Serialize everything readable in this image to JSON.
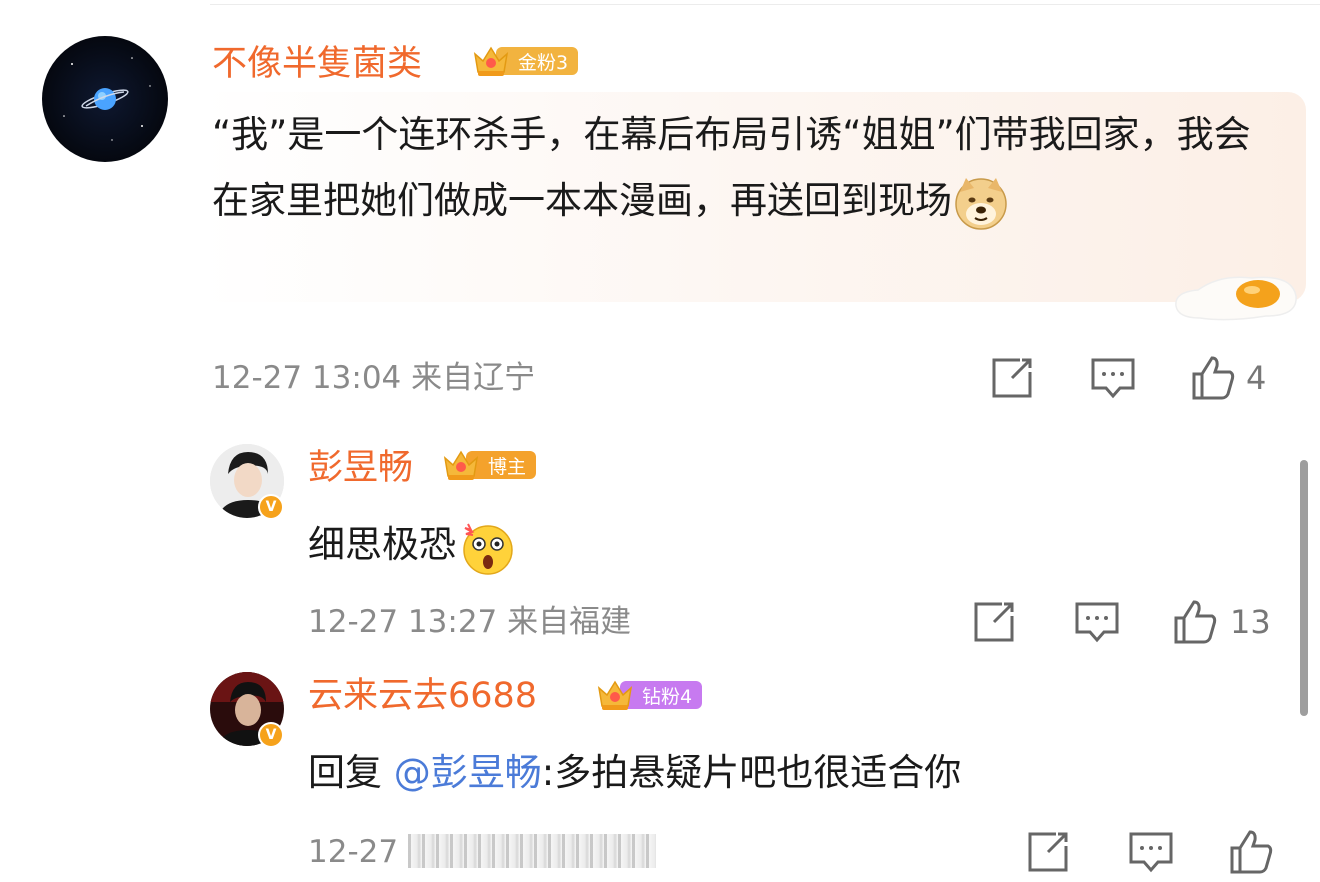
{
  "comments": [
    {
      "username": "不像半隻菌类",
      "badge_label": "金粉3",
      "badge_color": "#f2b33f",
      "text": "“我”是一个连环杀手，在幕后布局引诱“姐姐”们带我回家，我会在家里把她们做成一本本漫画，再送回到现场",
      "date": "12-27 13:04",
      "location": "来自辽宁",
      "likes": "4"
    },
    {
      "username": "彭昱畅",
      "badge_label": "博主",
      "badge_color": "#f4a22c",
      "text": "细思极恐",
      "date": "12-27 13:27",
      "location": "来自福建",
      "likes": "13"
    },
    {
      "username": "云来云去6688",
      "badge_label": "钻粉4",
      "badge_color": "#c77af0",
      "reply_prefix": "回复",
      "mention": "@彭昱畅",
      "text": ":多拍悬疑片吧也很适合你",
      "date": "12-27",
      "likes": ""
    }
  ],
  "icons": [
    "share-icon",
    "comment-icon",
    "like-icon",
    "crown-icon",
    "verified-icon",
    "doge-emoji",
    "shocked-emoji",
    "fried-egg-sticker"
  ]
}
